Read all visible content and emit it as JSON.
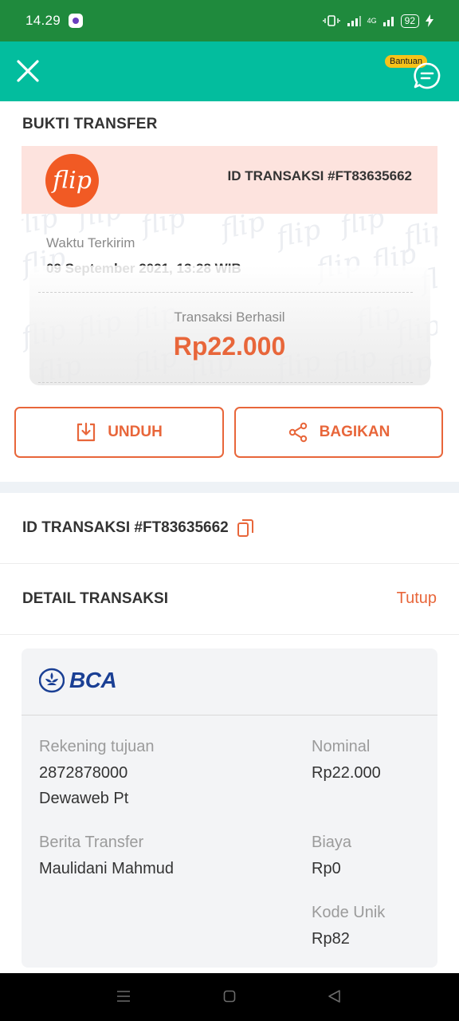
{
  "status_bar": {
    "time": "14.29",
    "network": "4G",
    "battery": "92"
  },
  "header": {
    "help_label": "Bantuan"
  },
  "receipt": {
    "section_title": "BUKTI TRANSFER",
    "logo_text": "flip",
    "transaction_id": "ID TRANSAKSI #FT83635662",
    "sent_label": "Waktu Terkirim",
    "sent_datetime": "09 September 2021, 13:28 WIB",
    "status_label": "Transaksi Berhasil",
    "amount": "Rp22.000"
  },
  "actions": {
    "download_label": "UNDUH",
    "share_label": "BAGIKAN"
  },
  "transaction_id_row": "ID TRANSAKSI #FT83635662",
  "detail": {
    "title": "DETAIL TRANSAKSI",
    "toggle_label": "Tutup",
    "bank_name": "BCA",
    "account_label": "Rekening tujuan",
    "account_number": "2872878000",
    "account_name": "Dewaweb Pt",
    "message_label": "Berita Transfer",
    "message_value": "Maulidani Mahmud",
    "nominal_label": "Nominal",
    "nominal_value": "Rp22.000",
    "fee_label": "Biaya",
    "fee_value": "Rp0",
    "unique_code_label": "Kode Unik",
    "unique_code_value": "Rp82"
  },
  "colors": {
    "status_bar": "#1f8a3d",
    "app_bar": "#03bd9e",
    "accent": "#e8663a",
    "badge": "#f7c21a"
  }
}
